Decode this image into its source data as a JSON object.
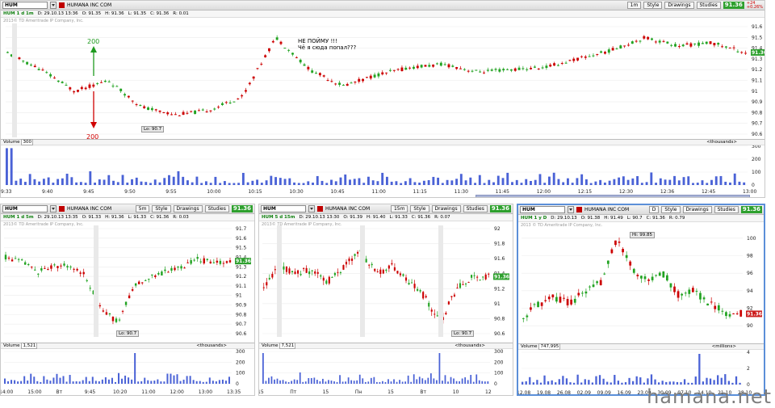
{
  "chart_data": [
    {
      "type": "candlestick",
      "panel": "top",
      "symbol": "HUM",
      "company": "HUMANA INC COM",
      "timeframe": "1 d 1m",
      "date": "29.10.13",
      "time": "13:36",
      "o": "91.35",
      "h": "91.36",
      "l": "91.35",
      "c": "91.36",
      "chg": "0.01",
      "ylim": [
        90.6,
        91.6
      ],
      "yticks": [
        "91.6",
        "91.5",
        "91.4",
        "91.3",
        "91.2",
        "91.1",
        "91",
        "90.9",
        "90.8",
        "90.7",
        "90.6"
      ],
      "xticks": [
        "9:33",
        "9:40",
        "9:45",
        "9:50",
        "9:55",
        "10:00",
        "10:15",
        "10:30",
        "10:45",
        "11:00",
        "11:15",
        "11:30",
        "11:45",
        "12:00",
        "12:15",
        "12:30",
        "12:36",
        "12:45",
        "13:00"
      ],
      "last": "91.36",
      "lo_label": "Lo: 90.7",
      "vol_label": "300",
      "vol_unit": "<thousands>",
      "vol_ticks": [
        "300",
        "200",
        "100",
        "0"
      ]
    },
    {
      "type": "candlestick",
      "panel": "bottom-left",
      "symbol": "HUM",
      "company": "HUMANA INC COM",
      "timeframe": "1 d 5m",
      "date": "29.10.13",
      "time": "13:35",
      "o": "91.33",
      "h": "91.36",
      "l": "91.33",
      "c": "91.36",
      "chg": "0.03",
      "ylim": [
        90.6,
        91.7
      ],
      "yticks": [
        "91.7",
        "91.6",
        "91.5",
        "91.4",
        "91.3",
        "91.2",
        "91.1",
        "91",
        "90.9",
        "90.8",
        "90.7",
        "90.6"
      ],
      "xticks": [
        "14:00",
        "15:00",
        "Вт",
        "9:45",
        "10:20",
        "11:00",
        "12:00",
        "13:00",
        "13:35"
      ],
      "last": "91.36",
      "lo_label": "Lo: 90.7",
      "vol_label": "1,521",
      "vol_unit": "<thousands>",
      "vol_ticks": [
        "300",
        "200",
        "100",
        "0"
      ]
    },
    {
      "type": "candlestick",
      "panel": "bottom-middle",
      "symbol": "HUM",
      "company": "HUMANA INC COM",
      "timeframe": "5 d 15m",
      "date": "29.10.13",
      "time": "13:30",
      "o": "91.39",
      "h": "91.40",
      "l": "91.33",
      "c": "91.36",
      "chg": "0.07",
      "ylim": [
        90.6,
        92
      ],
      "yticks": [
        "92",
        "91.8",
        "91.6",
        "91.4",
        "91.2",
        "91",
        "90.8",
        "90.6"
      ],
      "xticks": [
        "15",
        "Пт",
        "15",
        "Пн",
        "15",
        "Вт",
        "10",
        "12"
      ],
      "last": "91.36",
      "lo_label": "Lo: 90.7",
      "vol_label": "7,521",
      "vol_unit": "<thousands>",
      "vol_ticks": [
        "300",
        "200",
        "100",
        "0"
      ]
    },
    {
      "type": "candlestick",
      "panel": "bottom-right",
      "symbol": "HUM",
      "company": "HUMANA INC COM",
      "timeframe": "1 y D",
      "date": "29.10.13",
      "time": "",
      "o": "91.38",
      "h": "91.49",
      "l": "90.7",
      "c": "91.36",
      "chg": "0.79",
      "ylim": [
        89,
        101
      ],
      "yticks": [
        "100",
        "98",
        "96",
        "94",
        "92",
        "90"
      ],
      "xticks": [
        "12.08",
        "19.08",
        "26.08",
        "02.09",
        "09.09",
        "16.09",
        "23.09",
        "30.09",
        "07.10",
        "14.10",
        "21.10",
        "28.10"
      ],
      "last": "91.36",
      "hi_label": "Hi: 99.85",
      "small_label": "91.32",
      "vol_label": "747,995",
      "vol_unit": "<millions>",
      "vol_ticks": [
        "4",
        "2",
        "0"
      ]
    }
  ],
  "header": {
    "style": "Style",
    "drawings": "Drawings",
    "studies": "Studies",
    "price": "91.36",
    "chg_top": "+24",
    "chg_bot": "+0.26%"
  },
  "notes": {
    "line1": "НЕ ПОЙМУ !!!",
    "line2": "Чё я сюда попал???",
    "up": "200",
    "down": "200"
  },
  "copyright": {
    "main": "2013© TD Ameritrade IP Company, Inc.",
    "bottom_right": "2013 © TD Ameritrade IP Company, Inc."
  },
  "watermark": "hamana.net",
  "labels": {
    "volume": "Volume"
  },
  "colors": {
    "up": "#22a322",
    "down": "#cc0000",
    "last_up": "#2ea02e",
    "last_down": "#cc1e1e",
    "vol_bar": "#4a62d6"
  }
}
